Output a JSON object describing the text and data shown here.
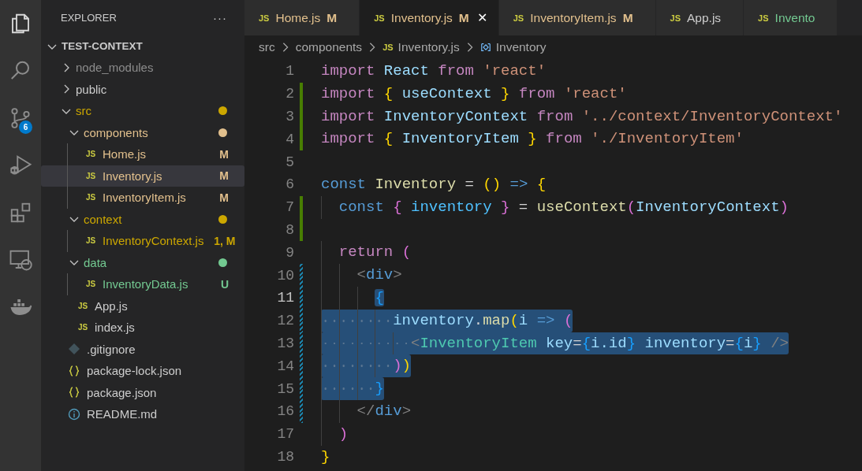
{
  "activity_bar": {
    "items": [
      {
        "kind": "files",
        "selected": true
      },
      {
        "kind": "search",
        "selected": false
      },
      {
        "kind": "scm",
        "selected": false,
        "badge": "6"
      },
      {
        "kind": "debug",
        "selected": false
      },
      {
        "kind": "extensions",
        "selected": false
      },
      {
        "kind": "remote",
        "selected": false
      },
      {
        "kind": "docker",
        "selected": false
      }
    ]
  },
  "sidebar": {
    "title": "EXPLORER",
    "more": "···",
    "root": {
      "label": "TEST-CONTEXT",
      "expanded": true
    },
    "tree": [
      {
        "label": "node_modules",
        "kind": "folder",
        "expanded": false,
        "color": "#8c8c8c",
        "selected": false
      },
      {
        "label": "public",
        "kind": "folder",
        "expanded": false,
        "color": "#cccccc",
        "selected": false
      },
      {
        "label": "src",
        "kind": "folder",
        "expanded": true,
        "color": "#cca700",
        "dot": true,
        "selected": false,
        "children": [
          {
            "label": "components",
            "kind": "folder",
            "expanded": true,
            "color": "#e2c08d",
            "dot": true,
            "selected": false,
            "children": [
              {
                "label": "Home.js",
                "kind": "js",
                "file_icon": "JS",
                "color": "#e2c08d",
                "badge": "M",
                "selected": false
              },
              {
                "label": "Inventory.js",
                "kind": "js",
                "file_icon": "JS",
                "color": "#e2c08d",
                "badge": "M",
                "selected": true
              },
              {
                "label": "InventoryItem.js",
                "kind": "js",
                "file_icon": "JS",
                "color": "#e2c08d",
                "badge": "M",
                "selected": false
              }
            ]
          },
          {
            "label": "context",
            "kind": "folder",
            "expanded": true,
            "color": "#cca700",
            "dot": true,
            "selected": false,
            "children": [
              {
                "label": "InventoryContext.js",
                "kind": "js",
                "file_icon": "JS",
                "color": "#cca700",
                "badge": "1, M",
                "selected": false
              }
            ]
          },
          {
            "label": "data",
            "kind": "folder",
            "expanded": true,
            "color": "#73c991",
            "dot": true,
            "selected": false,
            "children": [
              {
                "label": "InventoryData.js",
                "kind": "js",
                "file_icon": "JS",
                "color": "#73c991",
                "badge": "U",
                "selected": false
              }
            ]
          },
          {
            "label": "App.js",
            "kind": "js",
            "file_icon": "JS",
            "color": "#cccccc",
            "selected": false
          },
          {
            "label": "index.js",
            "kind": "js",
            "file_icon": "JS",
            "color": "#cccccc",
            "selected": false
          }
        ]
      },
      {
        "label": ".gitignore",
        "kind": "git",
        "color": "#cccccc",
        "selected": false
      },
      {
        "label": "package-lock.json",
        "kind": "json",
        "color": "#cccccc",
        "selected": false
      },
      {
        "label": "package.json",
        "kind": "json",
        "color": "#cccccc",
        "selected": false
      },
      {
        "label": "README.md",
        "kind": "info",
        "color": "#cccccc",
        "selected": false
      }
    ]
  },
  "tabs": [
    {
      "file_icon": "JS",
      "label": "Home.js",
      "badge": "M",
      "color": "#e2c08d",
      "selected": false
    },
    {
      "file_icon": "JS",
      "label": "Inventory.js",
      "badge": "M",
      "color": "#e2c08d",
      "selected": true,
      "close": "✕"
    },
    {
      "file_icon": "JS",
      "label": "InventoryItem.js",
      "badge": "M",
      "color": "#e2c08d",
      "selected": false
    },
    {
      "file_icon": "JS",
      "label": "App.js",
      "color": "#cccccc",
      "selected": false
    },
    {
      "file_icon": "JS",
      "label": "Invento",
      "color": "#73c991",
      "selected": false
    }
  ],
  "breadcrumb": [
    {
      "label": "src",
      "kind": "folder"
    },
    {
      "label": "components",
      "kind": "folder"
    },
    {
      "label": "Inventory.js",
      "kind": "js",
      "file_icon": "JS"
    },
    {
      "label": "Inventory",
      "kind": "symbol"
    }
  ],
  "editor": {
    "lines": [
      {
        "number": "1",
        "kind": "unchanged",
        "current": false,
        "selected": false,
        "tokens": [
          {
            "t": "import ",
            "kind": "kw"
          },
          {
            "t": "React ",
            "kind": "var"
          },
          {
            "t": "from ",
            "kind": "kw"
          },
          {
            "t": "'react'",
            "kind": "str"
          }
        ]
      },
      {
        "number": "2",
        "kind": "added",
        "current": false,
        "selected": false,
        "tokens": [
          {
            "t": "import ",
            "kind": "kw"
          },
          {
            "t": "{",
            "kind": "b1"
          },
          {
            "t": " useContext ",
            "kind": "var"
          },
          {
            "t": "}",
            "kind": "b1"
          },
          {
            "t": " from ",
            "kind": "kw"
          },
          {
            "t": "'react'",
            "kind": "str"
          }
        ]
      },
      {
        "number": "3",
        "kind": "added",
        "current": false,
        "selected": false,
        "tokens": [
          {
            "t": "import ",
            "kind": "kw"
          },
          {
            "t": "InventoryContext ",
            "kind": "var"
          },
          {
            "t": "from ",
            "kind": "kw"
          },
          {
            "t": "'../context/InventoryContext'",
            "kind": "str"
          }
        ]
      },
      {
        "number": "4",
        "kind": "added",
        "current": false,
        "selected": false,
        "tokens": [
          {
            "t": "import ",
            "kind": "kw"
          },
          {
            "t": "{",
            "kind": "b1"
          },
          {
            "t": " InventoryItem ",
            "kind": "var"
          },
          {
            "t": "}",
            "kind": "b1"
          },
          {
            "t": " from ",
            "kind": "kw"
          },
          {
            "t": "'./InventoryItem'",
            "kind": "str"
          }
        ]
      },
      {
        "number": "5",
        "kind": "unchanged",
        "current": false,
        "selected": false
      },
      {
        "number": "6",
        "kind": "unchanged",
        "current": false,
        "selected": false,
        "tokens": [
          {
            "t": "const ",
            "kind": "st"
          },
          {
            "t": "Inventory",
            "kind": "fn"
          },
          {
            "t": " = ",
            "kind": "p"
          },
          {
            "t": "()",
            "kind": "b1"
          },
          {
            "t": " => ",
            "kind": "st"
          },
          {
            "t": "{",
            "kind": "b1"
          }
        ]
      },
      {
        "number": "7",
        "kind": "added",
        "current": false,
        "selected": false,
        "tokens": [
          {
            "kind": "indent"
          },
          {
            "t": "const ",
            "kind": "st"
          },
          {
            "t": "{",
            "kind": "b2"
          },
          {
            "t": " inventory ",
            "kind": "cvar"
          },
          {
            "t": "}",
            "kind": "b2"
          },
          {
            "t": " = ",
            "kind": "p"
          },
          {
            "t": "useContext",
            "kind": "fn"
          },
          {
            "t": "(",
            "kind": "b2"
          },
          {
            "t": "InventoryContext",
            "kind": "var"
          },
          {
            "t": ")",
            "kind": "b2"
          }
        ]
      },
      {
        "number": "8",
        "kind": "added",
        "current": false,
        "selected": false
      },
      {
        "number": "9",
        "kind": "unchanged",
        "current": false,
        "selected": false,
        "tokens": [
          {
            "kind": "indent"
          },
          {
            "t": "return ",
            "kind": "kw"
          },
          {
            "t": "(",
            "kind": "b2"
          }
        ]
      },
      {
        "number": "10",
        "kind": "modified",
        "current": false,
        "selected": false,
        "tokens": [
          {
            "kind": "indent"
          },
          {
            "kind": "indent"
          },
          {
            "t": "<",
            "kind": "tag"
          },
          {
            "t": "div",
            "kind": "tn"
          },
          {
            "t": ">",
            "kind": "tag"
          }
        ]
      },
      {
        "number": "11",
        "kind": "modified",
        "current": true,
        "selected": true,
        "tokens": [
          {
            "kind": "indent"
          },
          {
            "kind": "indent"
          },
          {
            "kind": "indent"
          },
          {
            "t": "{",
            "kind": "b3"
          }
        ]
      },
      {
        "number": "12",
        "kind": "modified",
        "current": false,
        "selected": true,
        "tokens": [
          {
            "kind": "indent"
          },
          {
            "kind": "indent"
          },
          {
            "kind": "indent"
          },
          {
            "kind": "indent"
          },
          {
            "t": "inventory",
            "kind": "var"
          },
          {
            "t": ".",
            "kind": "p"
          },
          {
            "t": "map",
            "kind": "fn"
          },
          {
            "t": "(",
            "kind": "b1"
          },
          {
            "t": "i ",
            "kind": "var"
          },
          {
            "t": "=> ",
            "kind": "st"
          },
          {
            "t": "(",
            "kind": "b2"
          }
        ]
      },
      {
        "number": "13",
        "kind": "modified",
        "current": false,
        "selected": true,
        "tokens": [
          {
            "kind": "indent"
          },
          {
            "kind": "indent"
          },
          {
            "kind": "indent"
          },
          {
            "kind": "indent"
          },
          {
            "kind": "indent"
          },
          {
            "t": "<",
            "kind": "tag"
          },
          {
            "t": "InventoryItem ",
            "kind": "comp"
          },
          {
            "t": "key",
            "kind": "var"
          },
          {
            "t": "=",
            "kind": "p"
          },
          {
            "t": "{",
            "kind": "b3"
          },
          {
            "t": "i.id",
            "kind": "var"
          },
          {
            "t": "}",
            "kind": "b3"
          },
          {
            "t": " inventory",
            "kind": "var"
          },
          {
            "t": "=",
            "kind": "p"
          },
          {
            "t": "{",
            "kind": "b3"
          },
          {
            "t": "i",
            "kind": "var"
          },
          {
            "t": "}",
            "kind": "b3"
          },
          {
            "t": " />",
            "kind": "tag"
          }
        ]
      },
      {
        "number": "14",
        "kind": "modified",
        "current": false,
        "selected": true,
        "tokens": [
          {
            "kind": "indent"
          },
          {
            "kind": "indent"
          },
          {
            "kind": "indent"
          },
          {
            "kind": "indent"
          },
          {
            "t": ")",
            "kind": "b2"
          },
          {
            "t": ")",
            "kind": "b1"
          }
        ]
      },
      {
        "number": "15",
        "kind": "modified",
        "current": false,
        "selected": true,
        "tokens": [
          {
            "kind": "indent"
          },
          {
            "kind": "indent"
          },
          {
            "kind": "indent"
          },
          {
            "t": "}",
            "kind": "b3"
          }
        ]
      },
      {
        "number": "16",
        "kind": "modified",
        "current": false,
        "selected": false,
        "tokens": [
          {
            "kind": "indent"
          },
          {
            "kind": "indent"
          },
          {
            "t": "</",
            "kind": "tag"
          },
          {
            "t": "div",
            "kind": "tn"
          },
          {
            "t": ">",
            "kind": "tag"
          }
        ]
      },
      {
        "number": "17",
        "kind": "unchanged",
        "current": false,
        "selected": false,
        "tokens": [
          {
            "kind": "indent"
          },
          {
            "t": ")",
            "kind": "b2"
          }
        ]
      },
      {
        "number": "18",
        "kind": "unchanged",
        "current": false,
        "selected": false,
        "tokens": [
          {
            "t": "}",
            "kind": "b1"
          }
        ]
      }
    ]
  }
}
